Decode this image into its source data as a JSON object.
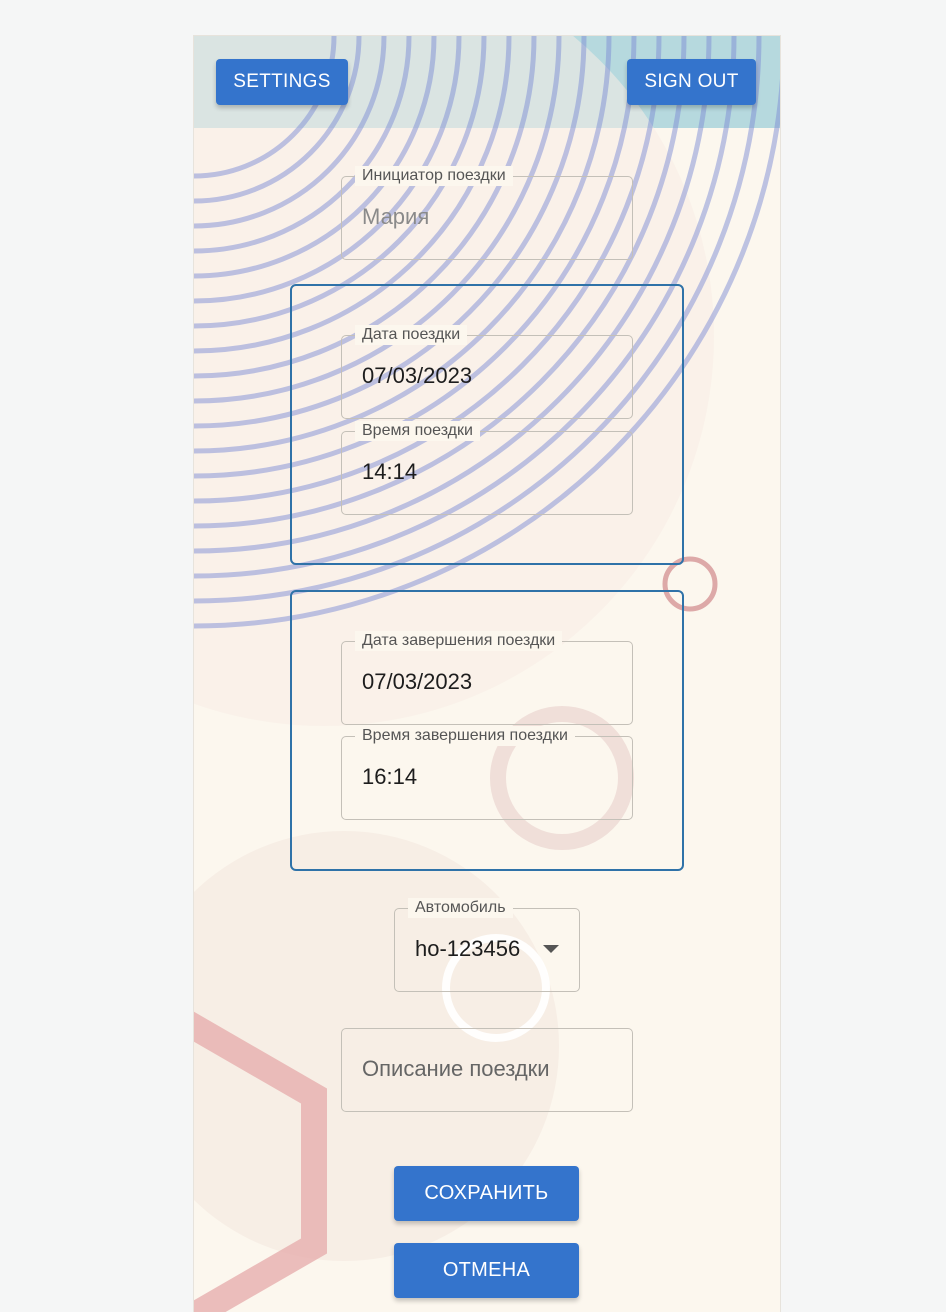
{
  "topbar": {
    "settings_label": "SETTINGS",
    "signout_label": "SIGN OUT"
  },
  "form": {
    "initiator": {
      "label": "Инициатор поездки",
      "value": "Мария"
    },
    "trip_date": {
      "label": "Дата поездки",
      "value": "07/03/2023"
    },
    "trip_time": {
      "label": "Время поездки",
      "value": "14:14"
    },
    "end_date": {
      "label": "Дата завершения поездки",
      "value": "07/03/2023"
    },
    "end_time": {
      "label": "Время завершения поездки",
      "value": "16:14"
    },
    "vehicle": {
      "label": "Автомобиль",
      "value": "ho-123456",
      "icon": "chevron-down-icon"
    },
    "description": {
      "placeholder": "Описание поездки"
    }
  },
  "actions": {
    "save_label": "СОХРАНИТЬ",
    "cancel_label": "ОТМЕНА"
  },
  "colors": {
    "accent": "#3474cc",
    "group_border": "#2f72a8",
    "background": "#fcf7ee",
    "header_tint": "#a9d4db",
    "line_color": "#7f8fd6",
    "decor_red": "#e6a9a9"
  }
}
